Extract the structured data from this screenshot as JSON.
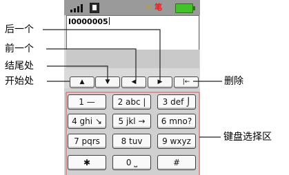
{
  "status_bar": {
    "signal_icon": "signal-bars-icon",
    "sim_icon": "sim-card-icon",
    "ime_indicator": "笔",
    "battery_icon": "battery-icon",
    "battery_color": "#43c22a"
  },
  "input": {
    "value": "I0000005"
  },
  "nav_buttons": [
    {
      "name": "home",
      "glyph": "▲"
    },
    {
      "name": "end",
      "glyph": "▼"
    },
    {
      "name": "previous",
      "glyph": "◀"
    },
    {
      "name": "next",
      "glyph": "▶"
    },
    {
      "name": "delete",
      "glyph": "|←"
    }
  ],
  "keypad": {
    "keys": [
      {
        "name": "key-1",
        "label": "1 —"
      },
      {
        "name": "key-2",
        "label": "2 abc |"
      },
      {
        "name": "key-3",
        "label": "3 def ⌡"
      },
      {
        "name": "key-4",
        "label": "4 ghi ↘"
      },
      {
        "name": "key-5",
        "label": "5 jkl →"
      },
      {
        "name": "key-6",
        "label": "6 mno?"
      },
      {
        "name": "key-7",
        "label": "7 pqrs"
      },
      {
        "name": "key-8",
        "label": "8  tuv"
      },
      {
        "name": "key-9",
        "label": "9 wxyz"
      },
      {
        "name": "key-star",
        "label": "✱"
      },
      {
        "name": "key-0",
        "label": "0 ⎵"
      },
      {
        "name": "key-hash",
        "label": "#"
      }
    ]
  },
  "callouts": {
    "next": "后一个",
    "previous": "前一个",
    "end": "结尾处",
    "home": "开始处",
    "delete": "删除",
    "keypad": "键盘选择区"
  }
}
